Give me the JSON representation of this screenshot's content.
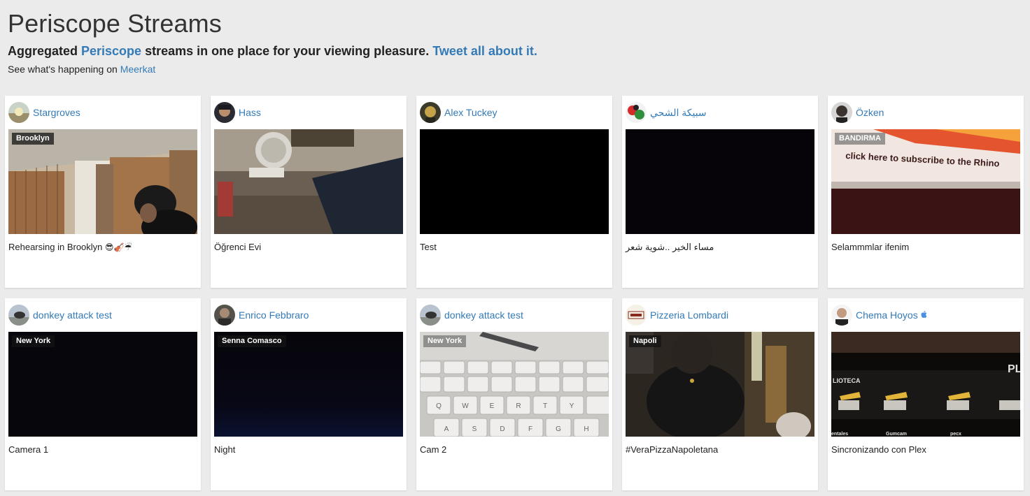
{
  "header": {
    "title": "Periscope Streams",
    "subtitle_pre": "Aggregated ",
    "subtitle_link": "Periscope",
    "subtitle_mid": " streams in one place for your viewing pleasure. ",
    "tweet_link": "Tweet all about it.",
    "see_pre": "See what's happening on ",
    "see_link": "Meerkat"
  },
  "streams": [
    {
      "user": "Stargroves",
      "location": "Brooklyn",
      "caption": "Rehearsing in Brooklyn",
      "emoji": "😎🎻☔",
      "avatar": "landscape-avatar-icon"
    },
    {
      "user": "Hass",
      "location": "",
      "caption": "Öğrenci Evi",
      "avatar": "person-avatar-icon"
    },
    {
      "user": "Alex Tuckey",
      "location": "",
      "caption": "Test",
      "avatar": "person-avatar-icon"
    },
    {
      "user": "سبيكة الشحي",
      "location": "",
      "caption": "مساء الخير ..شوية شعر",
      "avatar": "cartoon-avatar-icon"
    },
    {
      "user": "Özken",
      "location": "BANDIRMA",
      "caption": "Selammmlar ifenim",
      "avatar": "person-avatar-icon"
    },
    {
      "user": "donkey attack test",
      "location": "New York",
      "caption": "Camera 1",
      "avatar": "bird-avatar-icon"
    },
    {
      "user": "Enrico Febbraro",
      "location": "Senna Comasco",
      "caption": "Night",
      "avatar": "person-avatar-icon"
    },
    {
      "user": "donkey attack test",
      "location": "New York",
      "caption": "Cam 2",
      "avatar": "bird-avatar-icon"
    },
    {
      "user": "Pizzeria Lombardi",
      "location": "Napoli",
      "caption": "#VeraPizzaNapoletana",
      "avatar": "logo-avatar-icon"
    },
    {
      "user": "Chema Hoyos",
      "location": "",
      "caption": "Sincronizando con Plex",
      "avatar": "person-avatar-icon",
      "verified_icon": "apple-icon"
    }
  ],
  "thumb_text": {
    "banner": "click here to subscribe to the Rhino",
    "plex_label": "LIOTECA",
    "plex_logo": "PL",
    "plex_items": [
      "entales",
      "Gumcam",
      "pecx"
    ],
    "keyboard_row": [
      "Q",
      "W",
      "E",
      "R",
      "T",
      "Y"
    ],
    "keyboard_row2": [
      "A",
      "S",
      "D",
      "F",
      "G",
      "H"
    ]
  },
  "colors": {
    "link": "#337ab7",
    "background": "#ebebeb",
    "card": "#ffffff"
  }
}
